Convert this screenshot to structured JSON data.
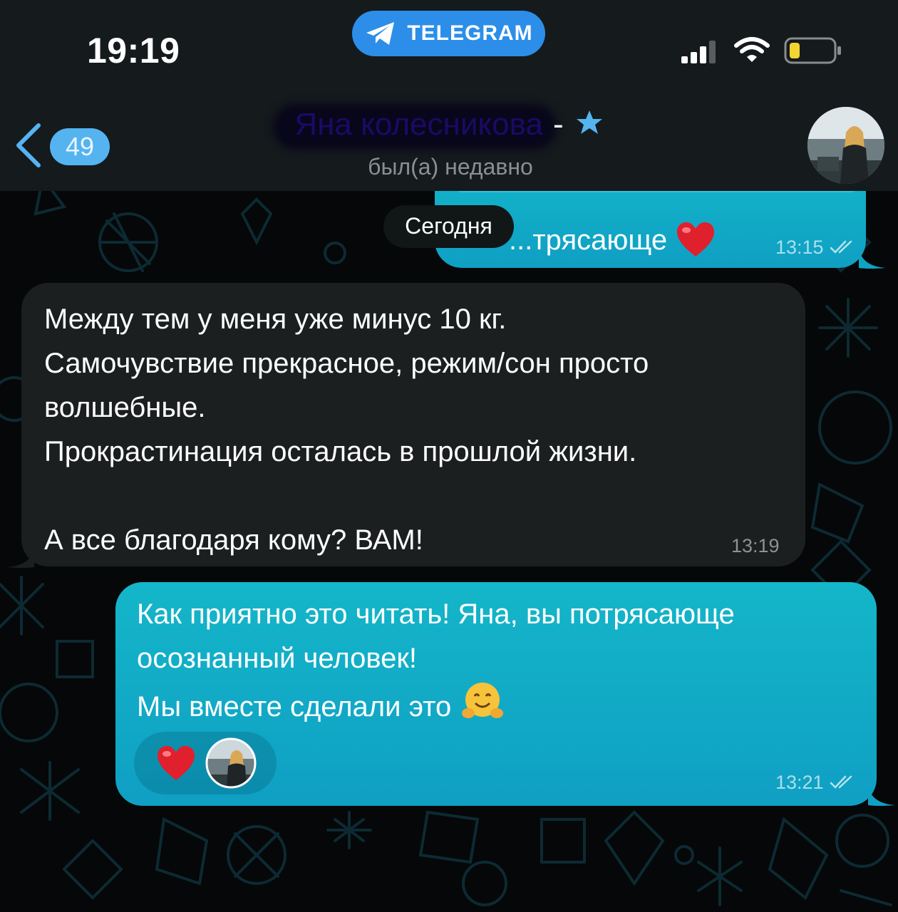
{
  "status_bar": {
    "time": "19:19",
    "app_pill": "TELEGRAM",
    "icons": [
      "telegram-plane-icon",
      "signal-icon",
      "wifi-icon",
      "battery-low-icon"
    ]
  },
  "header": {
    "back_count": "49",
    "contact_name": "Яна колесникова",
    "title_suffix": "-",
    "status": "был(а) недавно",
    "icons": [
      "back-chevron-icon",
      "star-icon",
      "avatar-photo"
    ]
  },
  "chat": {
    "date_separator": "Сегодня",
    "messages": [
      {
        "direction": "outgoing",
        "text": "...трясающе",
        "emoji": "heart",
        "time": "13:15",
        "read": true
      },
      {
        "direction": "incoming",
        "text": "Между тем у меня уже минус 10 кг.\nСамочувствие прекрасное, режим/сон просто волшебные.\nПрокрастинация осталась в прошлой жизни.\n\nА все благодаря кому? ВАМ!",
        "time": "13:19"
      },
      {
        "direction": "outgoing",
        "text": "Как приятно это читать! Яна, вы потрясающе осознанный человек!\nМы вместе сделали это",
        "emoji": "hugging-face",
        "time": "13:21",
        "read": true,
        "reactions": [
          "heart",
          "reactor-avatar"
        ]
      }
    ]
  },
  "colors": {
    "accent": "#2c8ee8",
    "outgoing_bubble": "#14b6c9",
    "incoming_bubble": "#1c1f20",
    "background": "#050708"
  }
}
